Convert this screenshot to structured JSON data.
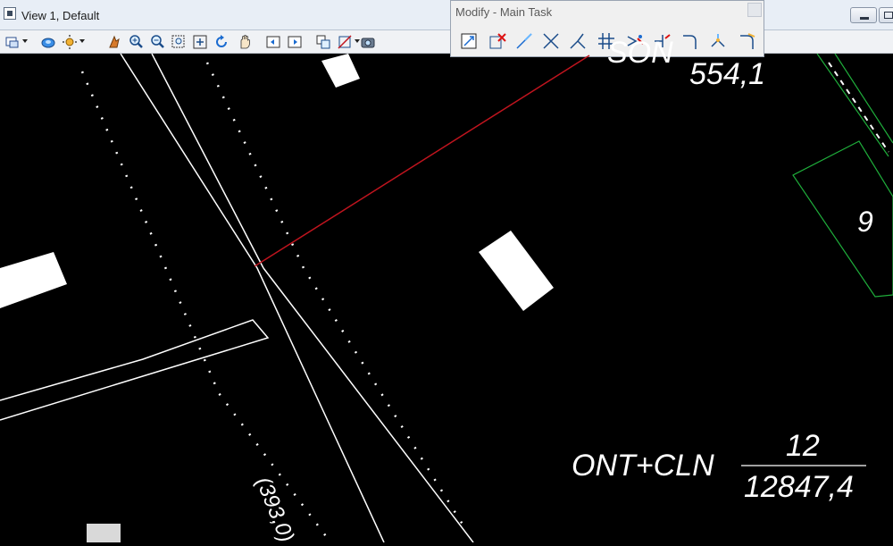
{
  "window": {
    "title": "View 1, Default"
  },
  "modify_dialog": {
    "title": "Modify - Main Task"
  },
  "view_toolbar": {
    "icons": [
      "view-attributes-icon",
      "display-style-icon",
      "shading-icon",
      "update-view-icon",
      "zoom-in-icon",
      "zoom-out-icon",
      "window-area-icon",
      "fit-view-icon",
      "rotate-view-icon",
      "pan-view-icon",
      "view-previous-icon",
      "view-next-icon",
      "copy-view-icon",
      "clip-volume-icon",
      "camera-icon"
    ]
  },
  "modify_tools": [
    "modify-element-icon",
    "delete-part-icon",
    "extend-line-icon",
    "trim-icon",
    "trim-to-intersection-icon",
    "trim-multiple-icon",
    "intelli-trim-icon",
    "extend-elements-icon",
    "fillet-icon",
    "chamfer-icon",
    "partial-delete-icon"
  ],
  "drawing": {
    "labels": {
      "son": "SON",
      "area_top": "554,1",
      "parcel_number": "9",
      "measure": "(393,0)",
      "code": "ONT+CLN",
      "fraction_top": "12",
      "fraction_bottom": "12847,4"
    },
    "colors": {
      "background": "#000000",
      "lines": "#ffffff",
      "red_line": "#c0141e",
      "green_parcel": "#1fae3b"
    }
  }
}
